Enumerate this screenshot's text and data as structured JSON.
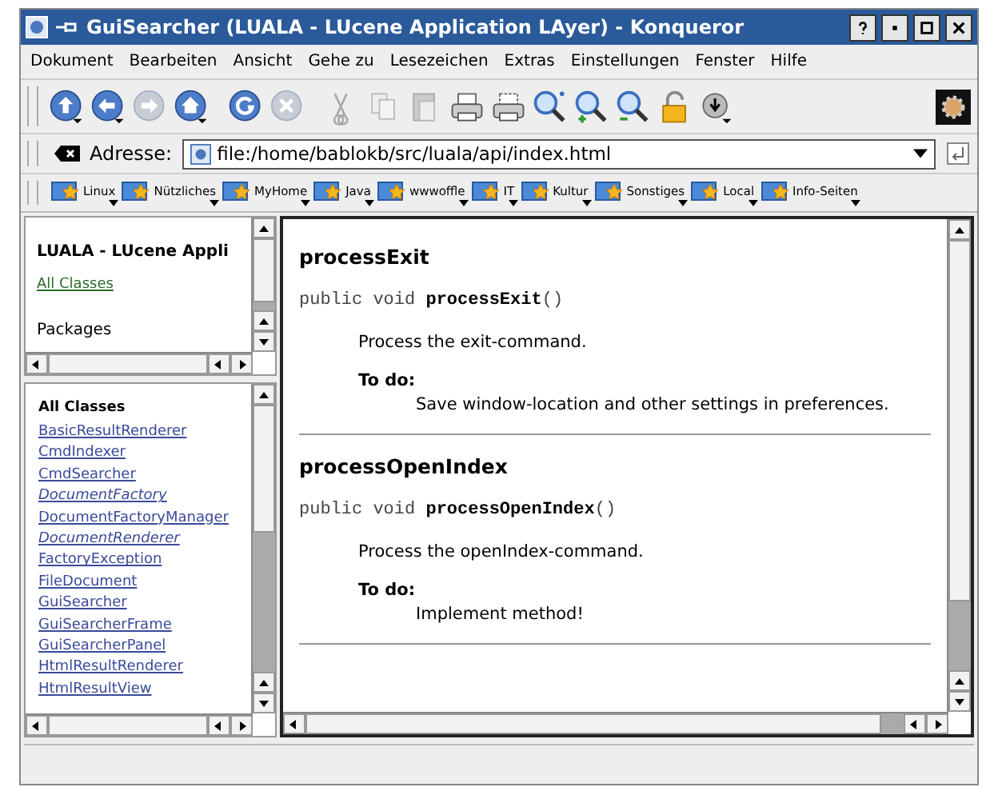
{
  "window": {
    "title": "GuiSearcher (LUALA - LUcene Application LAyer) - Konqueror"
  },
  "menu": [
    "Dokument",
    "Bearbeiten",
    "Ansicht",
    "Gehe zu",
    "Lesezeichen",
    "Extras",
    "Einstellungen",
    "Fenster",
    "Hilfe"
  ],
  "address_bar": {
    "label": "Adresse:",
    "value": "file:/home/bablokb/src/luala/api/index.html"
  },
  "bookmarks": [
    "Linux",
    "Nützliches",
    "MyHome",
    "Java",
    "wwwoffle",
    "IT",
    "Kultur",
    "Sonstiges",
    "Local",
    "Info-Seiten"
  ],
  "overview_frame": {
    "title": "LUALA - LUcene Appli",
    "link": "All Classes",
    "label": "Packages"
  },
  "classes_frame": {
    "heading": "All Classes",
    "classes": [
      {
        "name": "BasicResultRenderer",
        "italic": false
      },
      {
        "name": "CmdIndexer",
        "italic": false
      },
      {
        "name": "CmdSearcher",
        "italic": false
      },
      {
        "name": "DocumentFactory",
        "italic": true
      },
      {
        "name": "DocumentFactoryManager",
        "italic": false
      },
      {
        "name": "DocumentRenderer",
        "italic": true
      },
      {
        "name": "FactoryException",
        "italic": false
      },
      {
        "name": "FileDocument",
        "italic": false
      },
      {
        "name": "GuiSearcher",
        "italic": false
      },
      {
        "name": "GuiSearcherFrame",
        "italic": false
      },
      {
        "name": "GuiSearcherPanel",
        "italic": false
      },
      {
        "name": "HtmlResultRenderer",
        "italic": false
      },
      {
        "name": "HtmlResultView",
        "italic": false
      }
    ]
  },
  "methods": [
    {
      "name": "processExit",
      "modifiers": "public void",
      "method": "processExit",
      "params": "()",
      "description": "Process the exit-command.",
      "todo_label": "To do:",
      "todo": "Save window-location and other settings in preferences."
    },
    {
      "name": "processOpenIndex",
      "modifiers": "public void",
      "method": "processOpenIndex",
      "params": "()",
      "description": "Process the openIndex-command.",
      "todo_label": "To do:",
      "todo": "Implement method!"
    }
  ]
}
